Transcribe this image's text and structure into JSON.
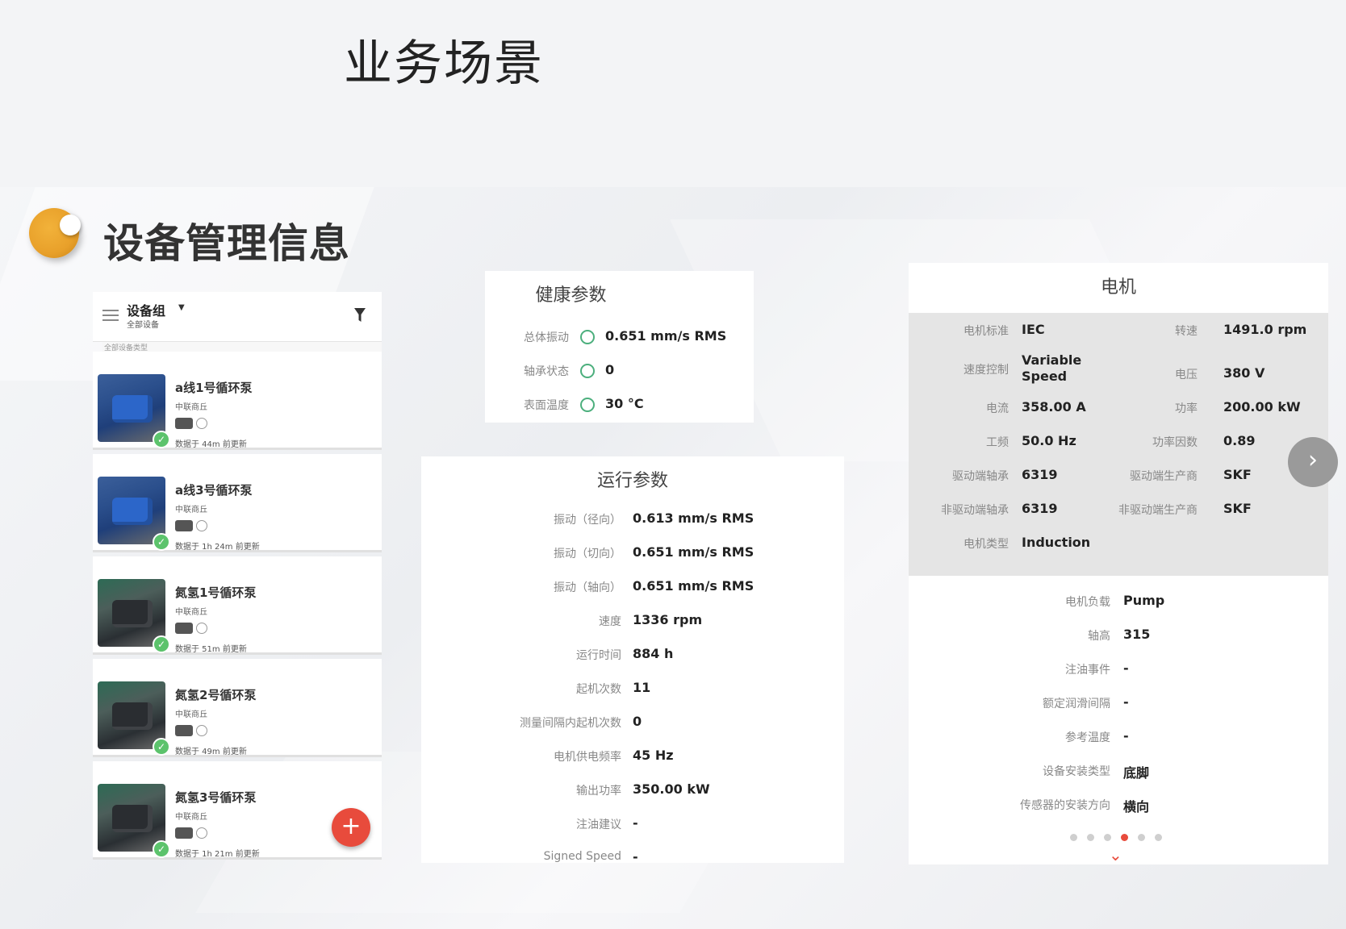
{
  "slide_title": "业务场景",
  "section_title": "设备管理信息",
  "device_list": {
    "group_title": "设备组",
    "group_subtitle": "全部设备",
    "filter_hint": "全部设备类型",
    "devices": [
      {
        "name": "a线1号循环泵",
        "site": "中联商丘",
        "updated": "数据于 44m 前更新",
        "thumb": "blue"
      },
      {
        "name": "a线3号循环泵",
        "site": "中联商丘",
        "updated": "数据于 1h 24m 前更新",
        "thumb": "blue"
      },
      {
        "name": "氮氢1号循环泵",
        "site": "中联商丘",
        "updated": "数据于 51m 前更新",
        "thumb": "green"
      },
      {
        "name": "氮氢2号循环泵",
        "site": "中联商丘",
        "updated": "数据于 49m 前更新",
        "thumb": "green"
      },
      {
        "name": "氮氢3号循环泵",
        "site": "中联商丘",
        "updated": "数据于 1h 21m 前更新",
        "thumb": "green"
      }
    ],
    "fab_label": "+"
  },
  "health": {
    "title": "健康参数",
    "rows": [
      {
        "label": "总体振动",
        "value": "0.651 mm/s RMS"
      },
      {
        "label": "轴承状态",
        "value": "0"
      },
      {
        "label": "表面温度",
        "value": "30 °C"
      }
    ]
  },
  "operation": {
    "title": "运行参数",
    "rows": [
      {
        "label": "振动（径向）",
        "value": "0.613 mm/s RMS"
      },
      {
        "label": "振动（切向）",
        "value": "0.651 mm/s RMS"
      },
      {
        "label": "振动（轴向）",
        "value": "0.651 mm/s RMS"
      },
      {
        "label": "速度",
        "value": "1336 rpm"
      },
      {
        "label": "运行时间",
        "value": "884 h"
      },
      {
        "label": "起机次数",
        "value": "11"
      },
      {
        "label": "测量间隔内起机次数",
        "value": "0"
      },
      {
        "label": "电机供电频率",
        "value": "45 Hz"
      },
      {
        "label": "输出功率",
        "value": "350.00 kW"
      },
      {
        "label": "注油建议",
        "value": "-"
      },
      {
        "label": "Signed Speed",
        "value": "-"
      }
    ]
  },
  "motor": {
    "title": "电机",
    "left_rows": [
      {
        "label": "电机标准",
        "value": "IEC"
      },
      {
        "label": "速度控制",
        "value": "Variable Speed"
      },
      {
        "label": "电流",
        "value": "358.00 A"
      },
      {
        "label": "工频",
        "value": "50.0 Hz"
      },
      {
        "label": "驱动端轴承",
        "value": "6319"
      },
      {
        "label": "非驱动端轴承",
        "value": "6319"
      },
      {
        "label": "电机类型",
        "value": "Induction"
      }
    ],
    "right_rows": [
      {
        "label": "转速",
        "value": "1491.0 rpm"
      },
      {
        "label": "电压",
        "value": "380 V"
      },
      {
        "label": "功率",
        "value": "200.00 kW"
      },
      {
        "label": "功率因数",
        "value": "0.89"
      },
      {
        "label": "驱动端生产商",
        "value": "SKF"
      },
      {
        "label": "非驱动端生产商",
        "value": "SKF"
      }
    ],
    "lower_rows": [
      {
        "label": "电机负载",
        "value": "Pump"
      },
      {
        "label": "轴高",
        "value": "315"
      },
      {
        "label": "注油事件",
        "value": "-"
      },
      {
        "label": "额定润滑间隔",
        "value": "-"
      },
      {
        "label": "参考温度",
        "value": "-"
      },
      {
        "label": "设备安装类型",
        "value": "底脚"
      },
      {
        "label": "传感器的安装方向",
        "value": "横向"
      }
    ],
    "next_label": "›",
    "pager_active": 4,
    "pager_count": 6
  },
  "colors": {
    "accent": "#e84b3c",
    "ok": "#5cc36c",
    "ring": "#4caf7d",
    "bullet": "#e8a02a"
  }
}
